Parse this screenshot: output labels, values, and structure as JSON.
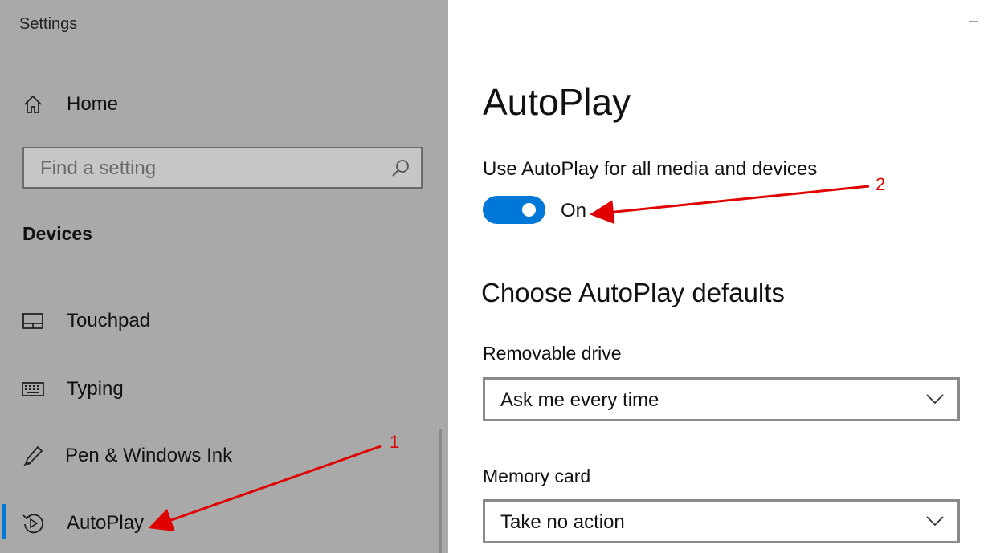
{
  "window": {
    "title": "Settings"
  },
  "sidebar": {
    "home_label": "Home",
    "search_placeholder": "Find a setting",
    "section_title": "Devices",
    "items": [
      {
        "label": "Touchpad",
        "icon": "touchpad-icon"
      },
      {
        "label": "Typing",
        "icon": "keyboard-icon"
      },
      {
        "label": "Pen & Windows Ink",
        "icon": "pen-icon"
      },
      {
        "label": "AutoPlay",
        "icon": "autoplay-icon",
        "selected": true
      }
    ]
  },
  "main": {
    "page_title": "AutoPlay",
    "toggle_label": "Use AutoPlay for all media and devices",
    "toggle_on": true,
    "toggle_state": "On",
    "defaults_title": "Choose AutoPlay defaults",
    "fields": [
      {
        "label": "Removable drive",
        "value": "Ask me every time"
      },
      {
        "label": "Memory card",
        "value": "Take no action"
      }
    ]
  },
  "annotations": {
    "one": "1",
    "two": "2"
  },
  "colors": {
    "accent": "#0078d7",
    "sidebar_bg": "#a9a9a9",
    "annotation": "#e00000"
  }
}
